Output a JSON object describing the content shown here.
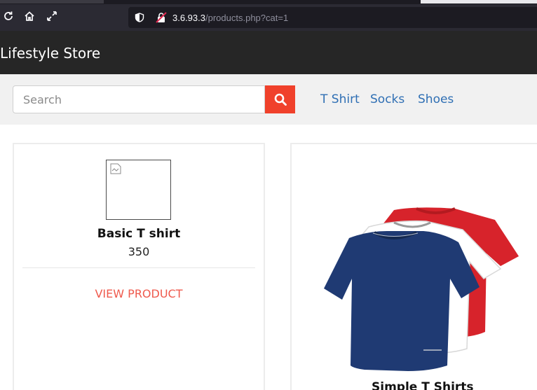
{
  "browser": {
    "url_host": "3.6.93.3",
    "url_path": "/products.php?cat=1"
  },
  "store": {
    "brand": "Lifestyle Store"
  },
  "search": {
    "placeholder": "Search"
  },
  "categories": [
    {
      "label": "T Shirt"
    },
    {
      "label": "Socks"
    },
    {
      "label": "Shoes"
    }
  ],
  "products": [
    {
      "name": "Basic T shirt",
      "price": "350",
      "action": "VIEW PRODUCT"
    },
    {
      "name": "Simple T Shirts"
    }
  ],
  "colors": {
    "header_bg": "#262626",
    "accent": "#f0412b",
    "link": "#2f6fb4",
    "view_link": "#ef5a4d"
  },
  "icons": [
    "reload-icon",
    "home-icon",
    "fullscreen-icon",
    "shield-icon",
    "insecure-lock-icon",
    "search-icon",
    "broken-image-icon"
  ]
}
